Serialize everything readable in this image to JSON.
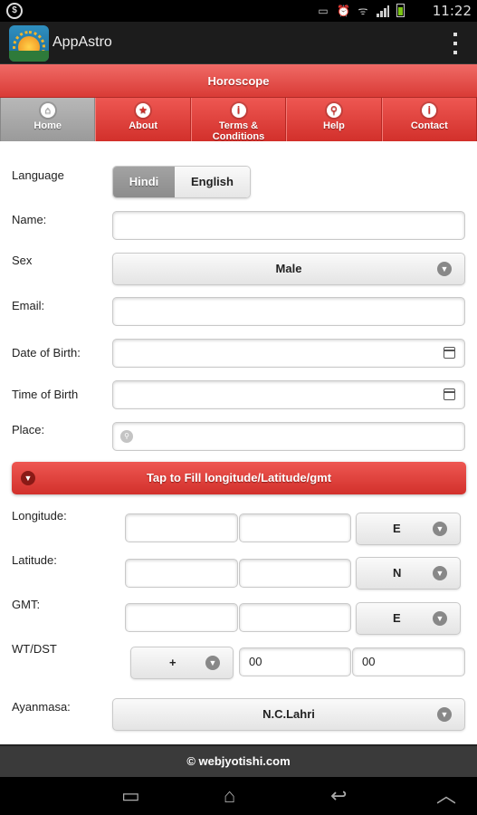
{
  "status_bar": {
    "time": "11:22"
  },
  "app": {
    "title": "AppAstro"
  },
  "header": {
    "title": "Horoscope"
  },
  "nav": [
    {
      "label": "Home",
      "icon": "home-icon"
    },
    {
      "label": "About",
      "icon": "star-icon"
    },
    {
      "label": "Terms & Conditions",
      "icon": "info-icon"
    },
    {
      "label": "Help",
      "icon": "search-icon"
    },
    {
      "label": "Contact",
      "icon": "info-icon"
    }
  ],
  "form": {
    "language_label": "Language",
    "language_options": [
      "Hindi",
      "English"
    ],
    "language_selected": "Hindi",
    "name_label": "Name:",
    "sex_label": "Sex",
    "sex_value": "Male",
    "email_label": "Email:",
    "dob_label": "Date of Birth:",
    "tob_label": "Time of Birth",
    "place_label": "Place:",
    "fill_button": "Tap to Fill longitude/Latitude/gmt",
    "longitude_label": "Longitude:",
    "longitude_dir": "E",
    "latitude_label": "Latitude:",
    "latitude_dir": "N",
    "gmt_label": "GMT:",
    "gmt_dir": "E",
    "wtdst_label": "WT/DST",
    "wtdst_sign": "+",
    "wtdst_hours": "00",
    "wtdst_minutes": "00",
    "ayanmasa_label": "Ayanmasa:",
    "ayanmasa_value": "N.C.Lahri"
  },
  "footer": {
    "text": "© webjyotishi.com"
  },
  "colors": {
    "accent_red": "#d93b36",
    "nav_active": "#9a9a9a"
  }
}
